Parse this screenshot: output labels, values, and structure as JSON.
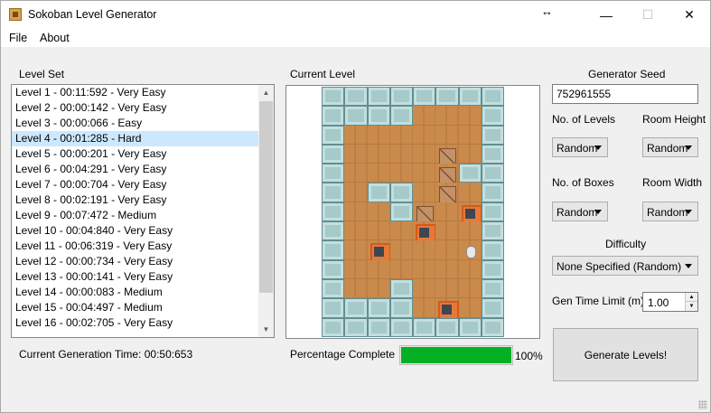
{
  "window": {
    "title": "Sokoban Level Generator",
    "resize_glyph": "↔",
    "minimize": "—",
    "maximize": "☐",
    "close": "✕"
  },
  "menu": {
    "file": "File",
    "about": "About"
  },
  "level_set": {
    "label": "Level Set",
    "items": [
      "Level 1 - 00:11:592 - Very Easy",
      "Level 2 - 00:00:142 - Very Easy",
      "Level 3 - 00:00:066 - Easy",
      "Level 4 - 00:01:285 - Hard",
      "Level 5 - 00:00:201 - Very Easy",
      "Level 6 - 00:04:291 - Very Easy",
      "Level 7 - 00:00:704 - Very Easy",
      "Level 8 - 00:02:191 - Very Easy",
      "Level 9 - 00:07:472 - Medium",
      "Level 10 - 00:04:840 - Very Easy",
      "Level 11 - 00:06:319 - Very Easy",
      "Level 12 - 00:00:734 - Very Easy",
      "Level 13 - 00:00:141 - Very Easy",
      "Level 14 - 00:00:083 - Medium",
      "Level 15 - 00:04:497 - Medium",
      "Level 16 - 00:02:705 - Very Easy"
    ],
    "selected_index": 3,
    "scroll_up": "▲",
    "scroll_down": "▼"
  },
  "current_level": {
    "label": "Current Level",
    "map": [
      "WWWWWWWW",
      "WWWWFFFW",
      "WFFFFFFW",
      "WFFFFCFW",
      "WFFFFCWW",
      "WFWWFCFW",
      "WFFWCFGW",
      "WFFFGFFW",
      "WFGFFFPW",
      "WFFFFFFW",
      "WFFWFFFW",
      "WWWWFGFW",
      "WWWWWWWW"
    ]
  },
  "status": {
    "generation_time": "Current Generation Time: 00:50:653",
    "percentage_label": "Percentage Complete",
    "percentage": 100,
    "percentage_text": "100%"
  },
  "generator": {
    "seed_label": "Generator Seed",
    "seed_value": "752961555",
    "num_levels_label": "No. of Levels",
    "num_levels_value": "Random",
    "room_height_label": "Room Height",
    "room_height_value": "Random",
    "num_boxes_label": "No. of Boxes",
    "num_boxes_value": "Random",
    "room_width_label": "Room Width",
    "room_width_value": "Random",
    "difficulty_label": "Difficulty",
    "difficulty_value": "None Specified (Random)",
    "time_limit_label": "Gen Time Limit (m)",
    "time_limit_value": "1.00",
    "spin_up": "▲",
    "spin_down": "▼",
    "generate_button": "Generate Levels!"
  }
}
